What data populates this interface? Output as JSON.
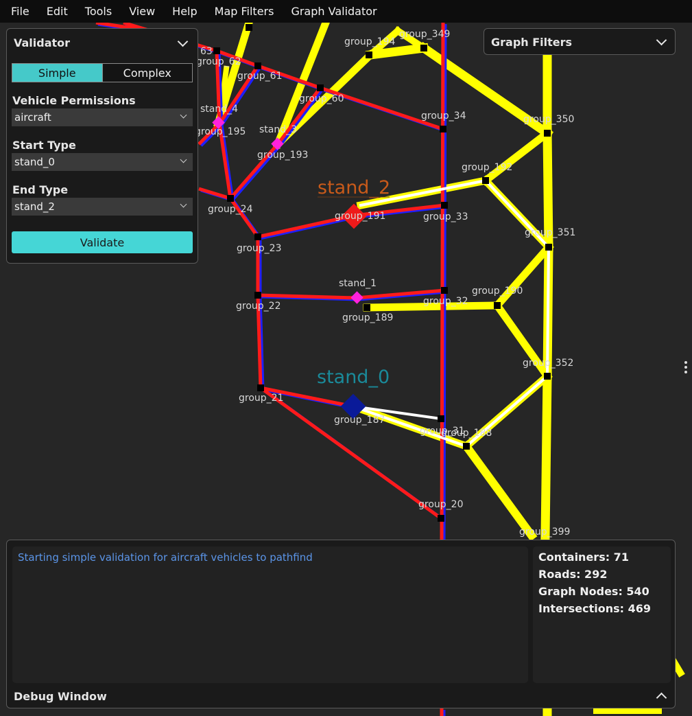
{
  "menu": [
    "File",
    "Edit",
    "Tools",
    "View",
    "Help",
    "Map Filters",
    "Graph Validator"
  ],
  "validator": {
    "title": "Validator",
    "modes": [
      "Simple",
      "Complex"
    ],
    "active_mode": "Simple",
    "vehicle_label": "Vehicle Permissions",
    "vehicle_value": "aircraft",
    "start_label": "Start Type",
    "start_value": "stand_0",
    "end_label": "End Type",
    "end_value": "stand_2",
    "validate_label": "Validate"
  },
  "graph_filters": {
    "title": "Graph Filters"
  },
  "debug": {
    "title": "Debug Window",
    "log": [
      "Starting simple validation for aircraft vehicles to pathfind"
    ],
    "stats": [
      "Containers: 71",
      "Roads: 292",
      "Graph Nodes: 540",
      "Intersections: 469"
    ]
  },
  "map": {
    "colors": {
      "road_red": "#ff1a1a",
      "road_blue": "#1f1fff",
      "road_yellow": "#ffff00",
      "path_white": "#ffffff",
      "stand_pink": "#ff22dd",
      "start_marker": "#0a1a99",
      "end_marker": "#ee1a1a"
    },
    "node_labels": [
      "63",
      "group_62",
      "group_61",
      "group_60",
      "group_194",
      "group_349",
      "group_34",
      "group_350",
      "stand_4",
      "group_195",
      "stand_3",
      "group_193",
      "group_192",
      "group_24",
      "group_191",
      "group_33",
      "group_351",
      "group_23",
      "stand_1",
      "group_190",
      "group_22",
      "group_32",
      "group_189",
      "group_352",
      "group_21",
      "group_187",
      "group_31",
      "group_188",
      "group_20",
      "group_399"
    ],
    "stand_labels": {
      "start": "stand_0",
      "end": "stand_2"
    }
  }
}
